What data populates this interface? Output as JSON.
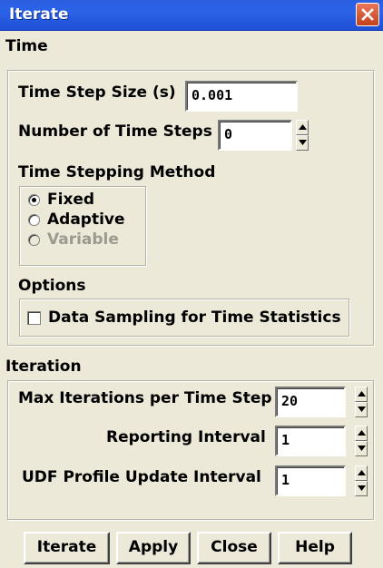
{
  "window": {
    "title": "Iterate"
  },
  "time": {
    "label": "Time",
    "time_step_size": {
      "label": "Time Step Size (s)",
      "value": "0.001"
    },
    "number_of_time_steps": {
      "label": "Number of Time Steps",
      "value": "0"
    },
    "stepping_method": {
      "label": "Time Stepping Method",
      "options": [
        {
          "label": "Fixed",
          "selected": true,
          "enabled": true
        },
        {
          "label": "Adaptive",
          "selected": false,
          "enabled": true
        },
        {
          "label": "Variable",
          "selected": false,
          "enabled": false
        }
      ]
    },
    "options": {
      "label": "Options",
      "data_sampling": {
        "label": "Data Sampling for Time Statistics",
        "checked": false
      }
    }
  },
  "iteration": {
    "label": "Iteration",
    "max_iterations": {
      "label": "Max Iterations per Time Step",
      "value": "20"
    },
    "reporting_interval": {
      "label": "Reporting Interval",
      "value": "1"
    },
    "udf_interval": {
      "label": "UDF Profile Update Interval",
      "value": "1"
    }
  },
  "buttons": {
    "iterate": "Iterate",
    "apply": "Apply",
    "close": "Close",
    "help": "Help"
  }
}
